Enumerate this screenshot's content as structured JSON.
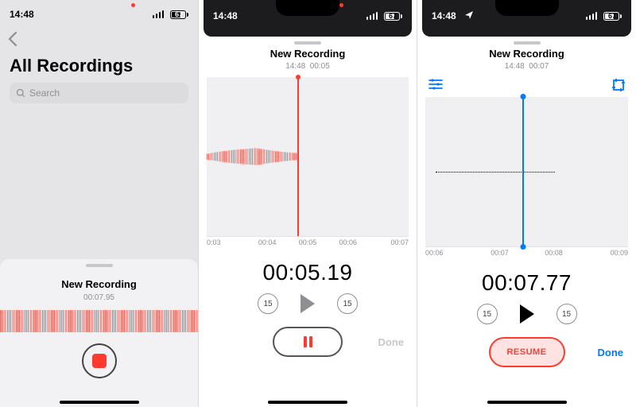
{
  "status": {
    "time": "14:48",
    "battery": "67"
  },
  "col1": {
    "title": "All Recordings",
    "search_placeholder": "Search",
    "sheet": {
      "title": "New Recording",
      "elapsed": "00:07.95"
    }
  },
  "col2": {
    "title": "New Recording",
    "subtitle_time": "14:48",
    "subtitle_dur": "00:05",
    "ruler": [
      "0:03",
      "00:04",
      "00:05",
      "00:06",
      "00:07"
    ],
    "bigtime": "00:05.19",
    "jump_seconds": "15",
    "done_label": "Done"
  },
  "col3": {
    "title": "New Recording",
    "subtitle_time": "14:48",
    "subtitle_dur": "00:07",
    "ruler": [
      "00:06",
      "00:07",
      "00:08",
      "00:09"
    ],
    "bigtime": "00:07.77",
    "jump_seconds": "15",
    "resume_label": "RESUME",
    "done_label": "Done"
  }
}
